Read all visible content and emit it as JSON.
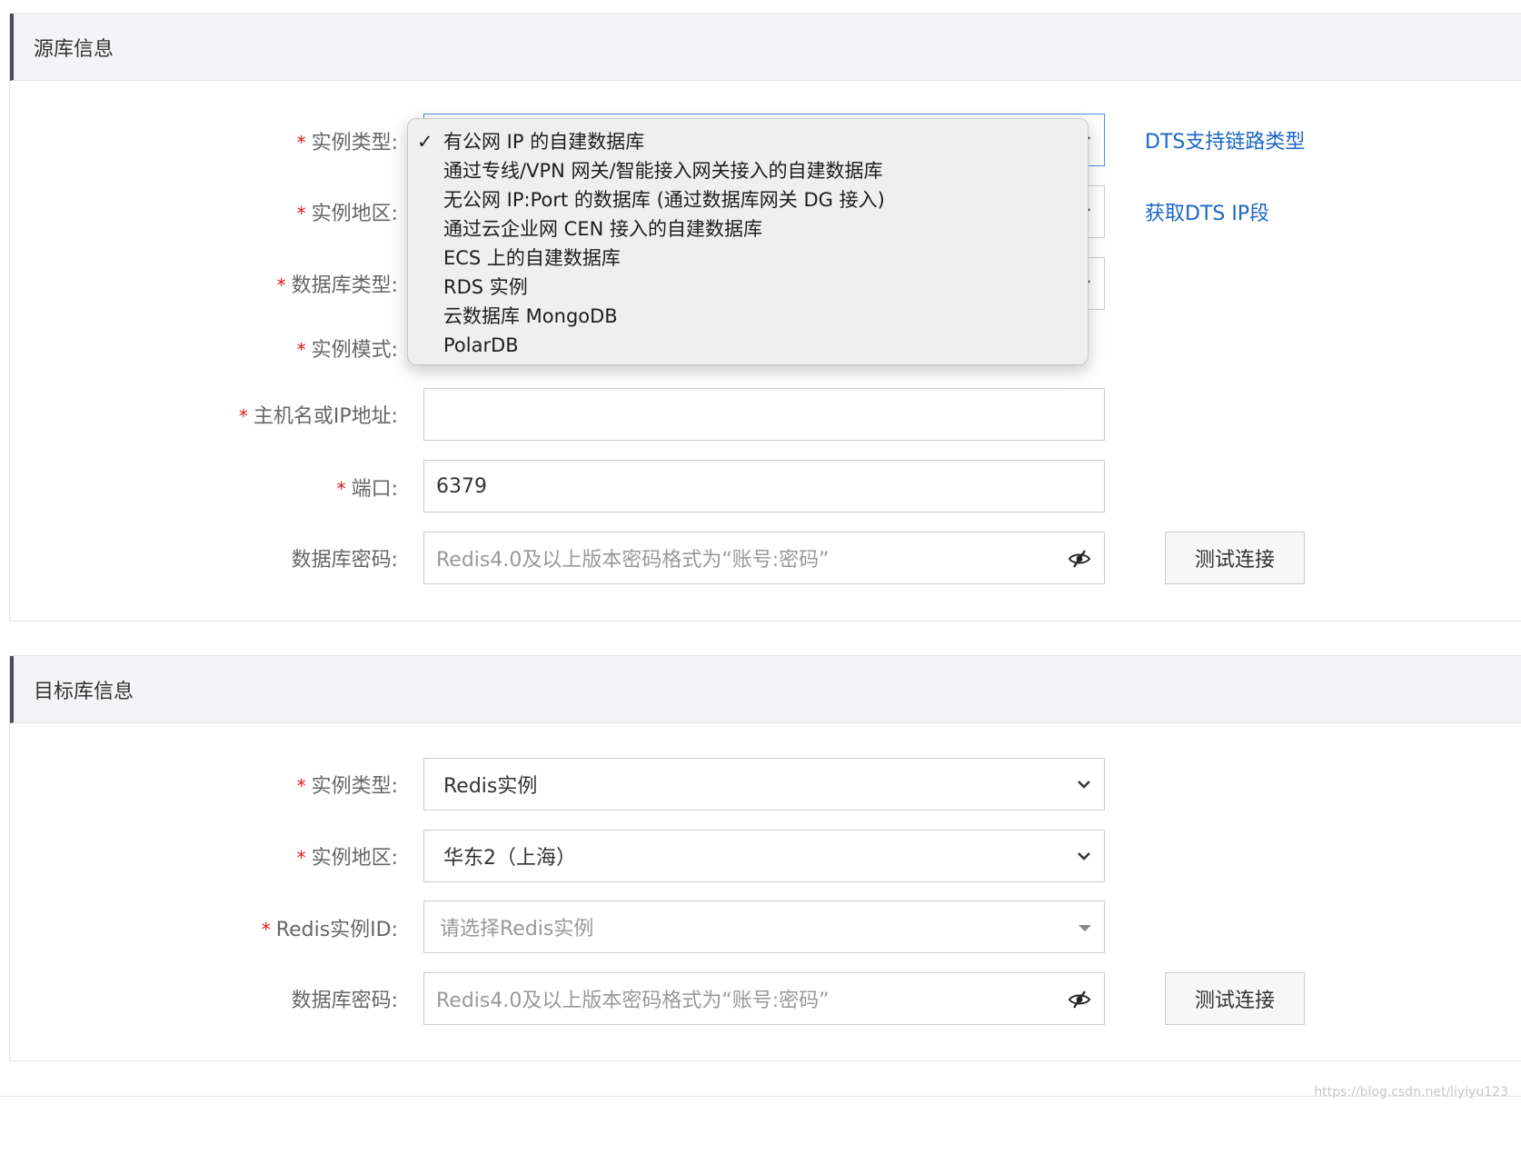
{
  "source": {
    "title": "源库信息",
    "instance_type_label": "实例类型:",
    "region_label": "实例地区:",
    "db_type_label": "数据库类型:",
    "mode_label": "实例模式:",
    "host_label": "主机名或IP地址:",
    "host_value": "",
    "port_label": "端口:",
    "port_value": "6379",
    "password_label": "数据库密码:",
    "password_placeholder": "Redis4.0及以上版本密码格式为“账号:密码”",
    "test_button": "测试连接",
    "link_dts_types": "DTS支持链路类型",
    "link_ip_range": "获取DTS IP段",
    "required_mark": "*"
  },
  "instance_type_dropdown": {
    "selected_index": 0,
    "check_glyph": "✓",
    "options": [
      "有公网 IP 的自建数据库",
      "通过专线/VPN 网关/智能接入网关接入的自建数据库",
      "无公网 IP:Port 的数据库 (通过数据库网关 DG 接入)",
      "通过云企业网 CEN 接入的自建数据库",
      "ECS 上的自建数据库",
      "RDS 实例",
      "云数据库 MongoDB",
      "PolarDB"
    ]
  },
  "target": {
    "title": "目标库信息",
    "instance_type_label": "实例类型:",
    "instance_type_value": "Redis实例",
    "region_label": "实例地区:",
    "region_value": "华东2（上海）",
    "instance_id_label": "Redis实例ID:",
    "instance_id_placeholder": "请选择Redis实例",
    "password_label": "数据库密码:",
    "password_placeholder": "Redis4.0及以上版本密码格式为“账号:密码”",
    "test_button": "测试连接",
    "required_mark": "*"
  },
  "watermark": "https://blog.csdn.net/liyiyu123",
  "colors": {
    "required": "#e0191e",
    "link": "#1a66c9",
    "header_bg": "#f4f4f6",
    "header_accent": "#4a4a5a"
  },
  "icons": {
    "chevron": "chevron-down-icon",
    "caret": "caret-down-icon",
    "eye": "eye-hidden-icon",
    "check": "check-icon"
  }
}
